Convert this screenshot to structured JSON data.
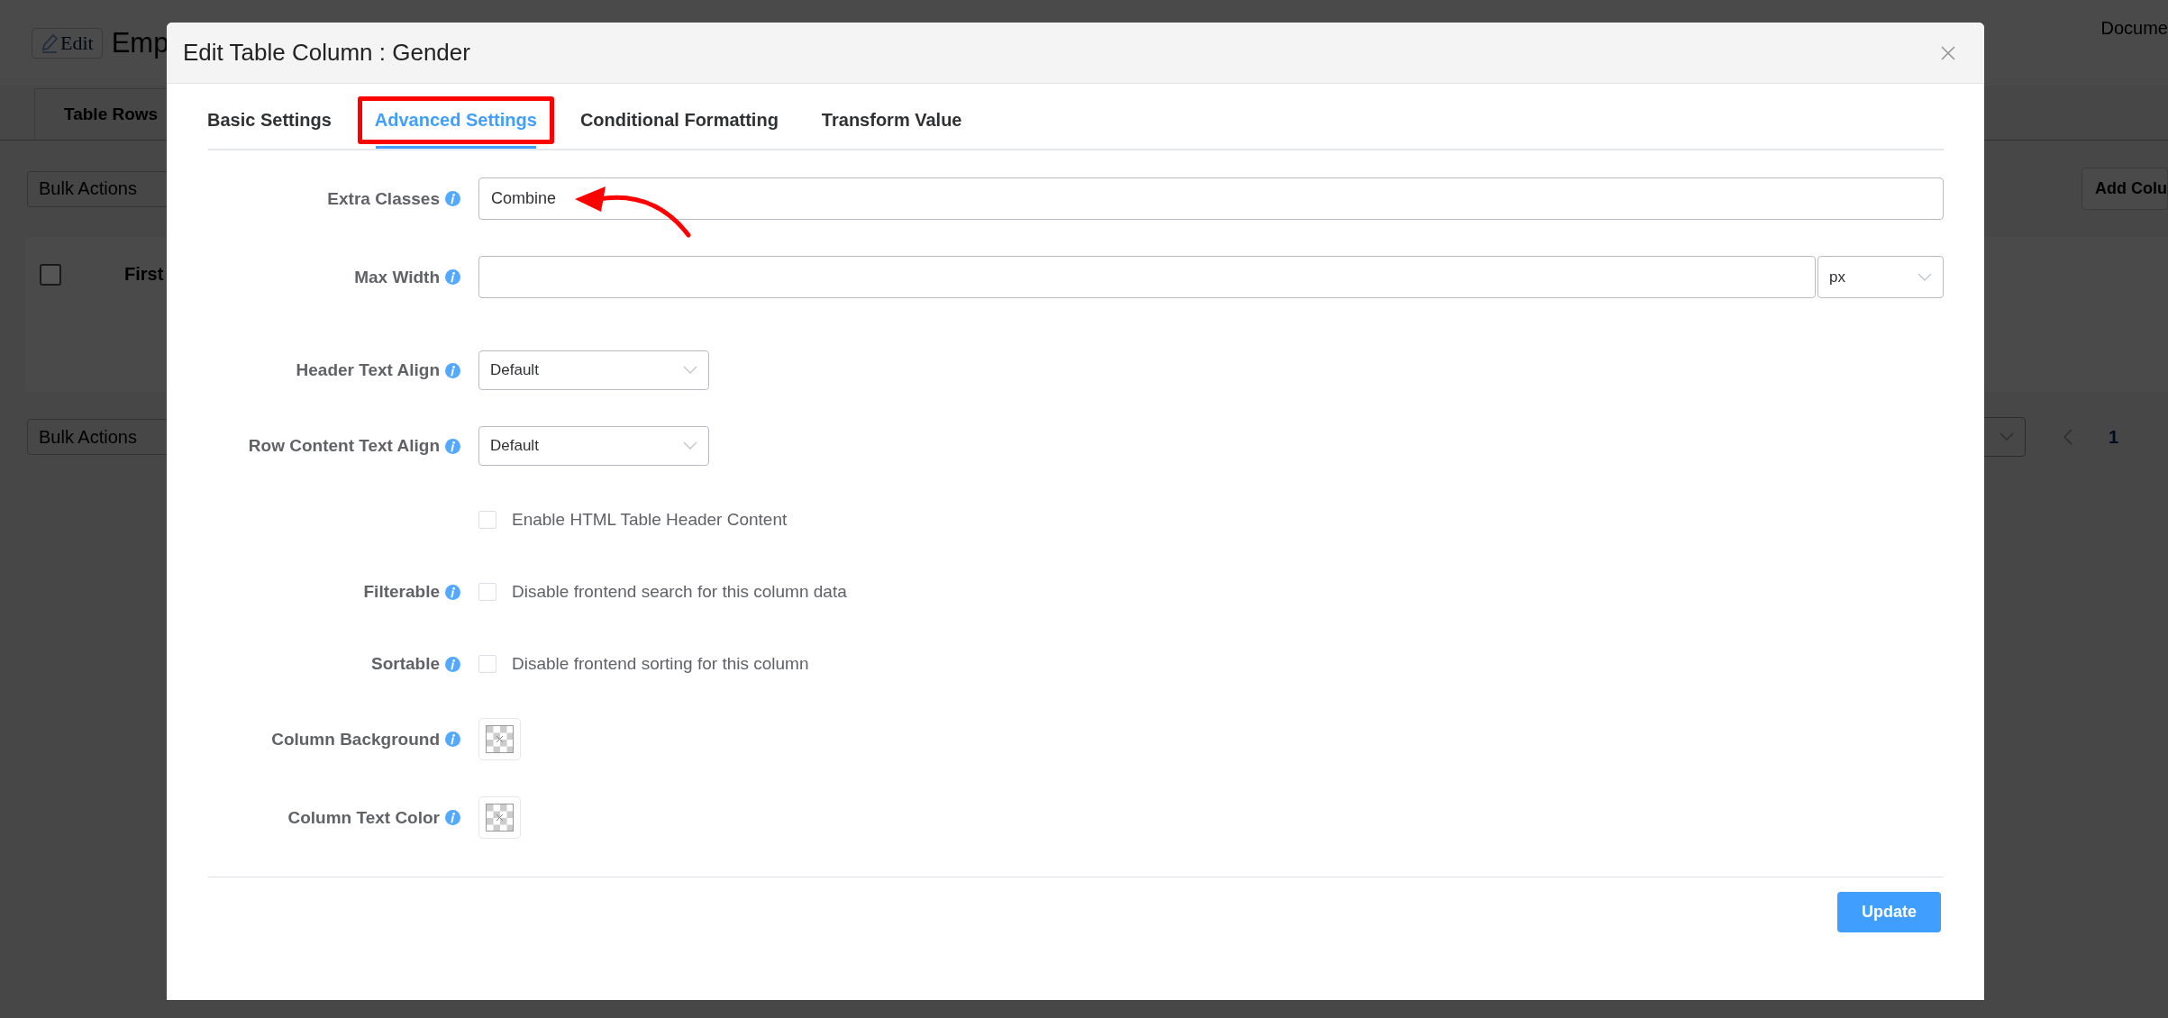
{
  "background": {
    "edit_button": "Edit",
    "title": "Emp",
    "docs_link": "Docume",
    "tab": "Table Rows",
    "bulk_actions_top": "Bulk Actions",
    "add_column_button": "Add Colu",
    "header_checkbox": {
      "checked": false
    },
    "column_header": "First",
    "bulk_actions_bottom": "Bulk Actions",
    "page_number": "1"
  },
  "dialog": {
    "title": "Edit Table Column : Gender",
    "tabs": [
      {
        "label": "Basic Settings",
        "selected": false,
        "highlighted": false
      },
      {
        "label": "Advanced Settings",
        "selected": true,
        "highlighted": true
      },
      {
        "label": "Conditional Formatting",
        "selected": false,
        "highlighted": false
      },
      {
        "label": "Transform Value",
        "selected": false,
        "highlighted": false
      }
    ],
    "rows": [
      {
        "kind": "text",
        "label": "Extra Classes",
        "value": "Combine",
        "arrow": true
      },
      {
        "kind": "text_unit",
        "label": "Max Width",
        "unit": "px"
      },
      {
        "kind": "select",
        "label": "Header Text Align",
        "value": "Default"
      },
      {
        "kind": "select",
        "label": "Row Content Text Align",
        "value": "Default"
      },
      {
        "kind": "checkbox",
        "text": "Enable HTML Table Header Content",
        "checked": false
      },
      {
        "kind": "checkbox",
        "label": "Filterable",
        "text": "Disable frontend search for this column data",
        "checked": false
      },
      {
        "kind": "checkbox",
        "label": "Sortable",
        "text": "Disable frontend sorting for this column",
        "checked": false
      },
      {
        "kind": "color",
        "label": "Column Background"
      },
      {
        "kind": "color",
        "label": "Column Text Color"
      }
    ],
    "button": "Update"
  }
}
